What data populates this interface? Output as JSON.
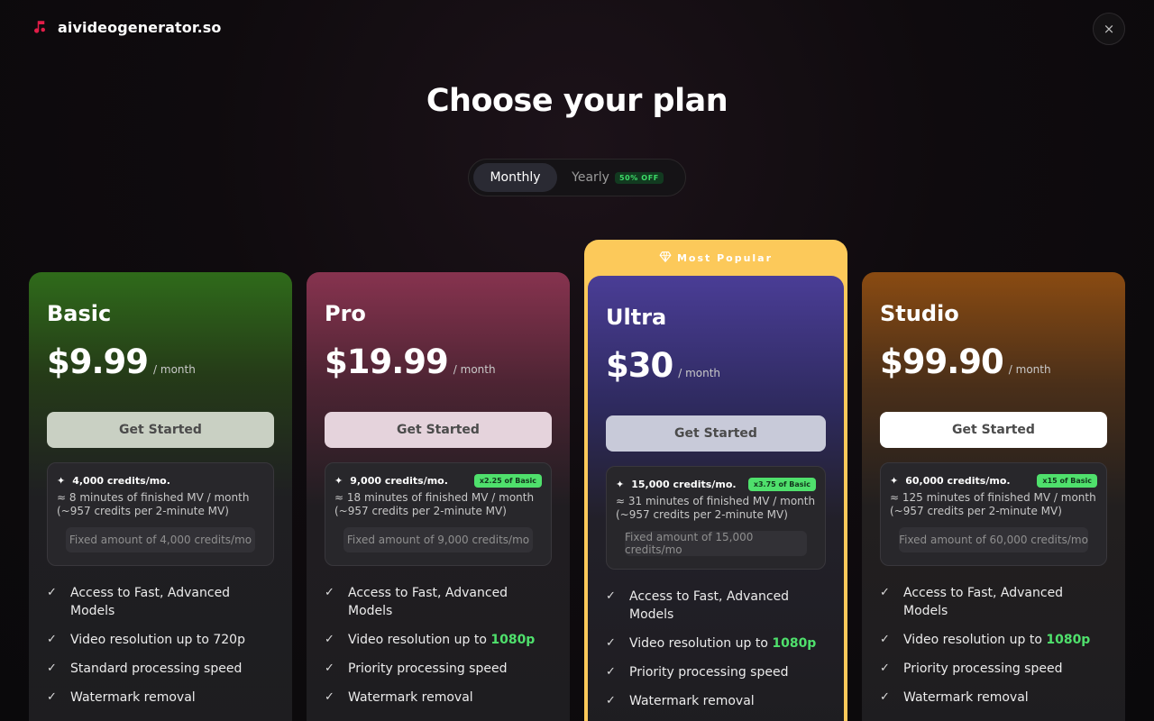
{
  "header": {
    "brand": "aivideogenerator.so",
    "close_icon": "×"
  },
  "title": "Choose your plan",
  "billing_toggle": {
    "monthly": "Monthly",
    "yearly": "Yearly",
    "yearly_badge": "50% OFF"
  },
  "popular_label": "Most Popular",
  "plans": [
    {
      "name": "Basic",
      "price": "$9.99",
      "period": "/ month",
      "cta": "Get Started",
      "credits": "4,000 credits/mo.",
      "multiplier": "",
      "credit_desc": "≈ 8 minutes of finished MV / month (~957 credits per 2-minute MV)",
      "fixed": "Fixed amount of 4,000 credits/mo",
      "features": [
        "Access to Fast, Advanced Models",
        "Video resolution up to 720p",
        "Standard processing speed",
        "Watermark removal"
      ]
    },
    {
      "name": "Pro",
      "price": "$19.99",
      "period": "/ month",
      "cta": "Get Started",
      "credits": "9,000 credits/mo.",
      "multiplier": "x2.25 of Basic",
      "credit_desc": "≈ 18 minutes of finished MV / month (~957 credits per 2-minute MV)",
      "fixed": "Fixed amount of 9,000 credits/mo",
      "features": [
        "Access to Fast, Advanced Models",
        "Video resolution up to ",
        "Priority processing speed",
        "Watermark removal"
      ],
      "resolution_highlight": "1080p"
    },
    {
      "name": "Ultra",
      "price": "$30",
      "period": "/ month",
      "cta": "Get Started",
      "credits": "15,000 credits/mo.",
      "multiplier": "x3.75 of Basic",
      "credit_desc": "≈ 31 minutes of finished MV / month (~957 credits per 2-minute MV)",
      "fixed": "Fixed amount of 15,000 credits/mo",
      "features": [
        "Access to Fast, Advanced Models",
        "Video resolution up to ",
        "Priority processing speed",
        "Watermark removal"
      ],
      "resolution_highlight": "1080p"
    },
    {
      "name": "Studio",
      "price": "$99.90",
      "period": "/ month",
      "cta": "Get Started",
      "credits": "60,000 credits/mo.",
      "multiplier": "x15 of Basic",
      "credit_desc": "≈ 125 minutes of finished MV / month (~957 credits per 2-minute MV)",
      "fixed": "Fixed amount of 60,000 credits/mo",
      "features": [
        "Access to Fast, Advanced Models",
        "Video resolution up to ",
        "Priority processing speed",
        "Watermark removal"
      ],
      "resolution_highlight": "1080p"
    }
  ],
  "colors": {
    "accent_green": "#4fe06c",
    "popular_gold": "#fcc95a",
    "brand_red": "#e11d48"
  }
}
